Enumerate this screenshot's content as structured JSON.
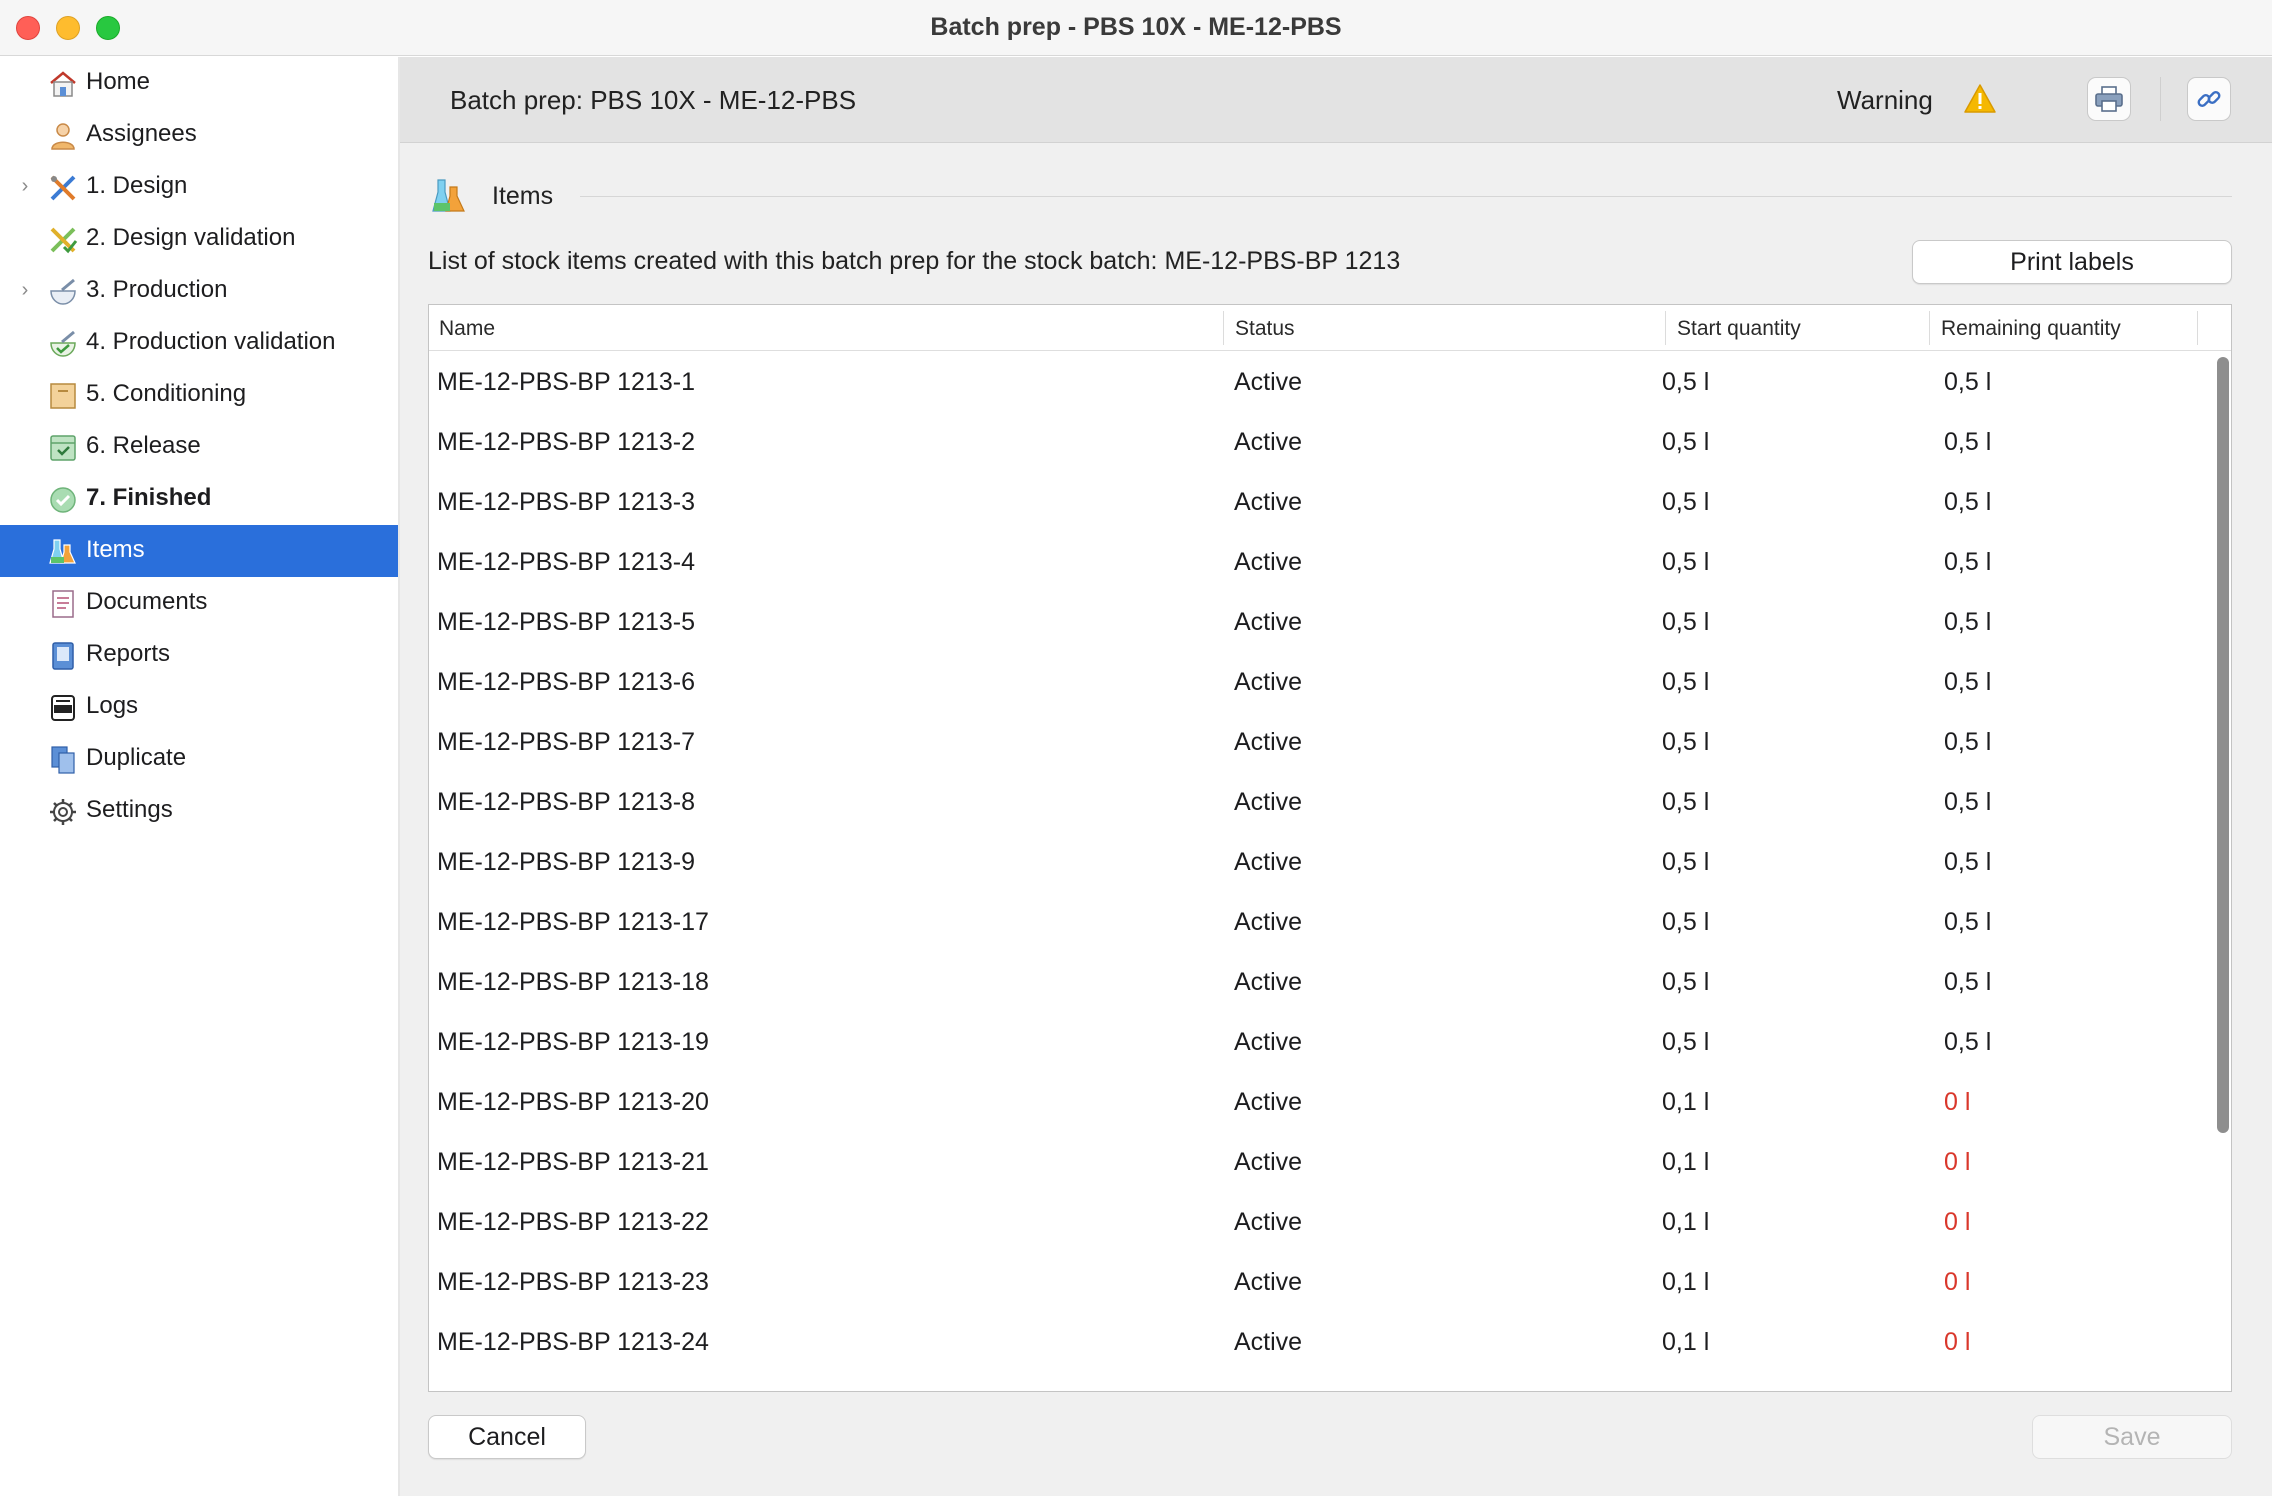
{
  "window": {
    "title": "Batch prep - PBS 10X - ME-12-PBS"
  },
  "sidebar": {
    "items": [
      {
        "label": "Home",
        "icon": "home-icon"
      },
      {
        "label": "Assignees",
        "icon": "person-icon"
      },
      {
        "label": "1. Design",
        "icon": "design-tools-icon",
        "expandable": true
      },
      {
        "label": "2. Design validation",
        "icon": "design-validation-icon"
      },
      {
        "label": "3. Production",
        "icon": "mortar-icon",
        "expandable": true
      },
      {
        "label": "4. Production validation",
        "icon": "mortar-check-icon"
      },
      {
        "label": "5. Conditioning",
        "icon": "box-icon"
      },
      {
        "label": "6. Release",
        "icon": "release-box-icon"
      },
      {
        "label": "7. Finished",
        "icon": "check-circle-icon",
        "bold": true
      },
      {
        "label": "Items",
        "icon": "flask-icon",
        "selected": true
      },
      {
        "label": "Documents",
        "icon": "document-icon"
      },
      {
        "label": "Reports",
        "icon": "report-icon"
      },
      {
        "label": "Logs",
        "icon": "log-icon"
      },
      {
        "label": "Duplicate",
        "icon": "duplicate-icon"
      },
      {
        "label": "Settings",
        "icon": "gear-icon"
      }
    ]
  },
  "header": {
    "title": "Batch prep: PBS 10X - ME-12-PBS",
    "warning_label": "Warning",
    "warning_color": "#f5b800"
  },
  "section": {
    "title": "Items"
  },
  "description": "List of stock items created with this batch prep for the stock batch: ME-12-PBS-BP 1213",
  "buttons": {
    "print_labels": "Print labels",
    "cancel": "Cancel",
    "save": "Save"
  },
  "table": {
    "columns": [
      "Name",
      "Status",
      "Start quantity",
      "Remaining quantity"
    ],
    "rows": [
      {
        "name": "ME-12-PBS-BP 1213-1",
        "status": "Active",
        "start": "0,5 l",
        "remaining": "0,5 l"
      },
      {
        "name": "ME-12-PBS-BP 1213-2",
        "status": "Active",
        "start": "0,5 l",
        "remaining": "0,5 l"
      },
      {
        "name": "ME-12-PBS-BP 1213-3",
        "status": "Active",
        "start": "0,5 l",
        "remaining": "0,5 l"
      },
      {
        "name": "ME-12-PBS-BP 1213-4",
        "status": "Active",
        "start": "0,5 l",
        "remaining": "0,5 l"
      },
      {
        "name": "ME-12-PBS-BP 1213-5",
        "status": "Active",
        "start": "0,5 l",
        "remaining": "0,5 l"
      },
      {
        "name": "ME-12-PBS-BP 1213-6",
        "status": "Active",
        "start": "0,5 l",
        "remaining": "0,5 l"
      },
      {
        "name": "ME-12-PBS-BP 1213-7",
        "status": "Active",
        "start": "0,5 l",
        "remaining": "0,5 l"
      },
      {
        "name": "ME-12-PBS-BP 1213-8",
        "status": "Active",
        "start": "0,5 l",
        "remaining": "0,5 l"
      },
      {
        "name": "ME-12-PBS-BP 1213-9",
        "status": "Active",
        "start": "0,5 l",
        "remaining": "0,5 l"
      },
      {
        "name": "ME-12-PBS-BP 1213-17",
        "status": "Active",
        "start": "0,5 l",
        "remaining": "0,5 l"
      },
      {
        "name": "ME-12-PBS-BP 1213-18",
        "status": "Active",
        "start": "0,5 l",
        "remaining": "0,5 l"
      },
      {
        "name": "ME-12-PBS-BP 1213-19",
        "status": "Active",
        "start": "0,5 l",
        "remaining": "0,5 l"
      },
      {
        "name": "ME-12-PBS-BP 1213-20",
        "status": "Active",
        "start": "0,1 l",
        "remaining": "0 l"
      },
      {
        "name": "ME-12-PBS-BP 1213-21",
        "status": "Active",
        "start": "0,1 l",
        "remaining": "0 l"
      },
      {
        "name": "ME-12-PBS-BP 1213-22",
        "status": "Active",
        "start": "0,1 l",
        "remaining": "0 l"
      },
      {
        "name": "ME-12-PBS-BP 1213-23",
        "status": "Active",
        "start": "0,1 l",
        "remaining": "0 l"
      },
      {
        "name": "ME-12-PBS-BP 1213-24",
        "status": "Active",
        "start": "0,1 l",
        "remaining": "0 l"
      }
    ],
    "empty_remaining_color": "#d9372b"
  },
  "colors": {
    "selection": "#2a6fdb"
  }
}
